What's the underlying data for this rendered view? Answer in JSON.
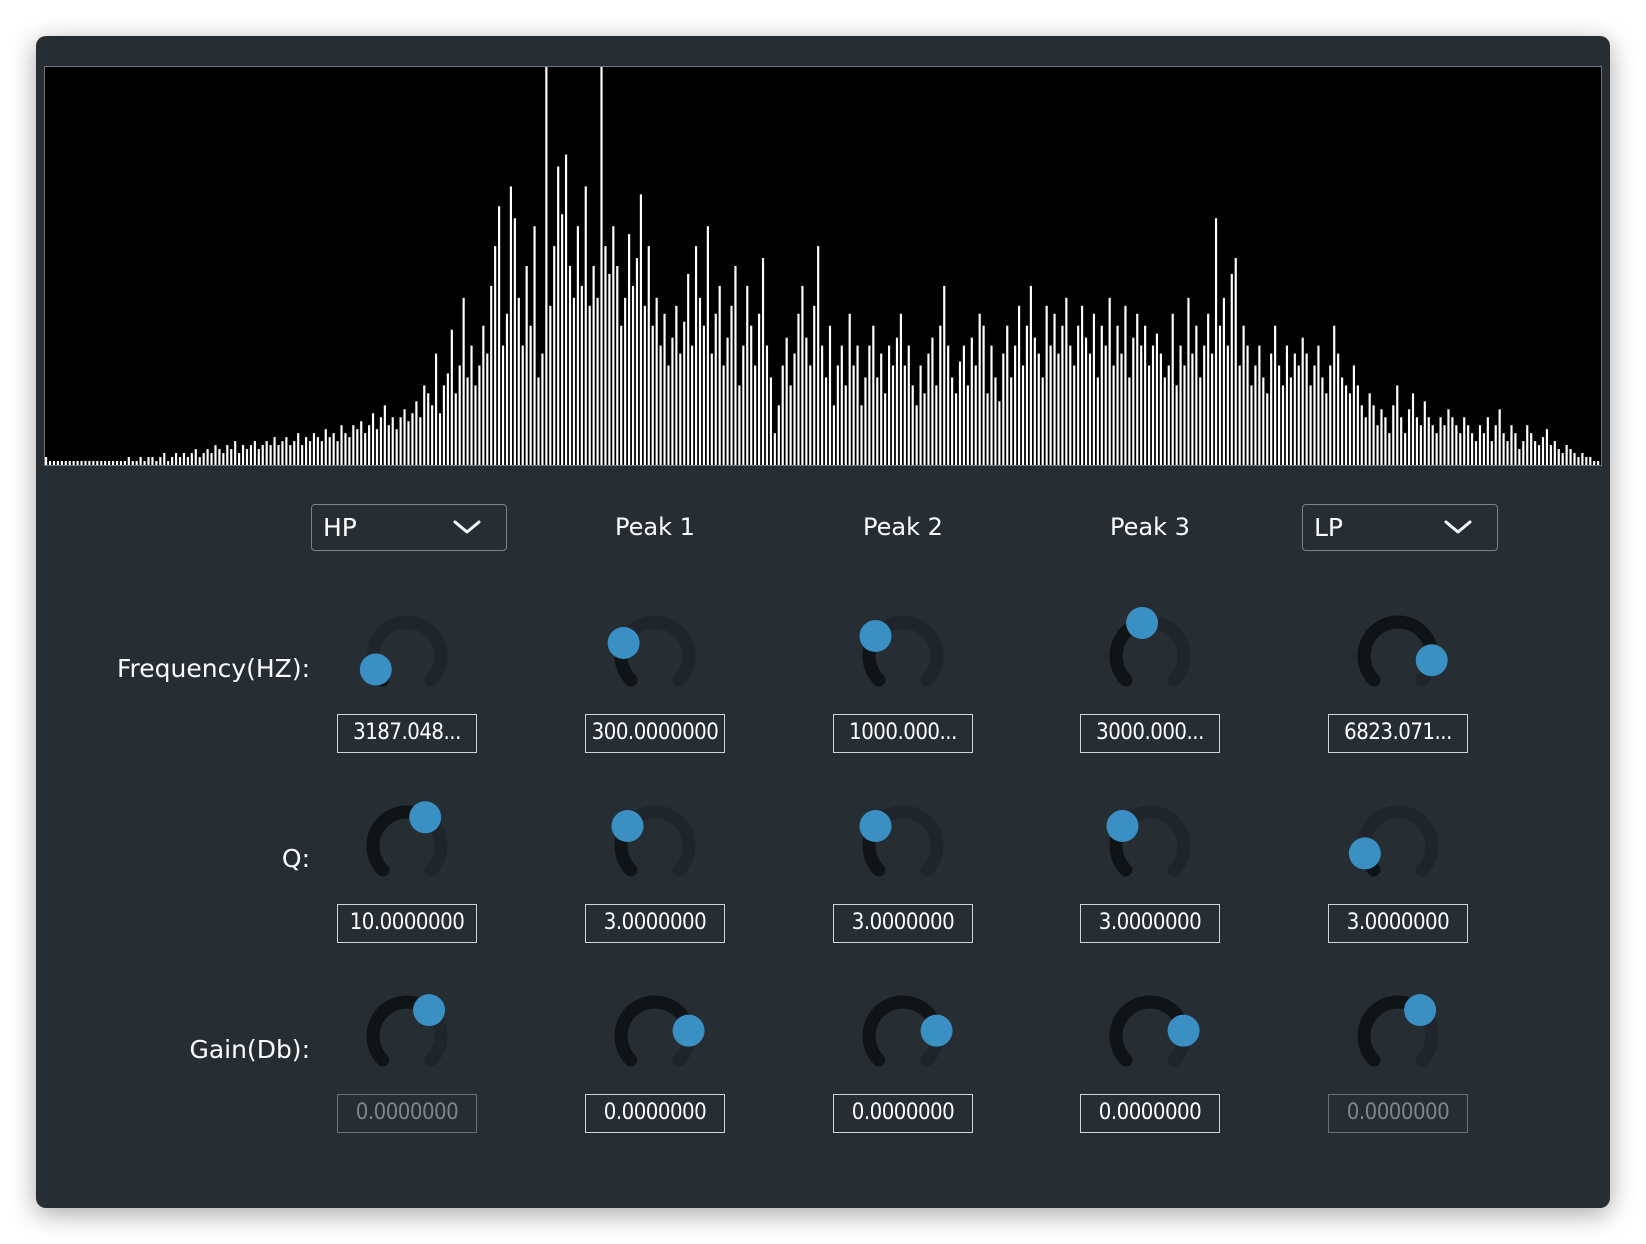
{
  "bands": [
    {
      "kind": "dropdown",
      "title": "HP",
      "enabled_gain": false
    },
    {
      "kind": "label",
      "title": "Peak 1",
      "enabled_gain": true
    },
    {
      "kind": "label",
      "title": "Peak 2",
      "enabled_gain": true
    },
    {
      "kind": "label",
      "title": "Peak 3",
      "enabled_gain": true
    },
    {
      "kind": "dropdown",
      "title": "LP",
      "enabled_gain": false
    }
  ],
  "rows": [
    {
      "label": "Frequency(HZ):",
      "key": "freq"
    },
    {
      "label": "Q:",
      "key": "q"
    },
    {
      "label": "Gain(Db):",
      "key": "gain"
    }
  ],
  "values": {
    "freq": [
      "3187.048...",
      "300.0000000",
      "1000.000...",
      "3000.000...",
      "6823.071..."
    ],
    "q": [
      "10.0000000",
      "3.0000000",
      "3.0000000",
      "3.0000000",
      "3.0000000"
    ],
    "gain": [
      "0.0000000",
      "0.0000000",
      "0.0000000",
      "0.0000000",
      "0.0000000"
    ]
  },
  "knob_levels": {
    "freq": [
      0.08,
      0.25,
      0.3,
      0.45,
      0.86
    ],
    "q": [
      0.62,
      0.3,
      0.3,
      0.3,
      0.12
    ],
    "gain": [
      0.65,
      0.8,
      0.8,
      0.8,
      0.65
    ]
  },
  "colors": {
    "knob_track": "#1f252a",
    "knob_fill": "#111416",
    "knob_thumb": "#3a8fc3",
    "spectrum_bar": "#ffffff",
    "panel": "#262d33"
  },
  "spectrum_levels": [
    0.02,
    0.01,
    0.01,
    0.01,
    0.01,
    0.01,
    0.01,
    0.01,
    0.01,
    0.01,
    0.01,
    0.01,
    0.01,
    0.01,
    0.01,
    0.01,
    0.01,
    0.01,
    0.01,
    0.01,
    0.01,
    0.02,
    0.01,
    0.01,
    0.02,
    0.01,
    0.02,
    0.02,
    0.01,
    0.02,
    0.03,
    0.01,
    0.02,
    0.03,
    0.02,
    0.03,
    0.02,
    0.03,
    0.04,
    0.02,
    0.03,
    0.04,
    0.03,
    0.05,
    0.04,
    0.03,
    0.05,
    0.04,
    0.06,
    0.03,
    0.05,
    0.04,
    0.05,
    0.06,
    0.04,
    0.05,
    0.06,
    0.05,
    0.07,
    0.05,
    0.06,
    0.07,
    0.05,
    0.06,
    0.08,
    0.05,
    0.07,
    0.06,
    0.08,
    0.07,
    0.06,
    0.09,
    0.07,
    0.08,
    0.06,
    0.1,
    0.08,
    0.07,
    0.1,
    0.09,
    0.11,
    0.08,
    0.1,
    0.13,
    0.09,
    0.12,
    0.15,
    0.1,
    0.12,
    0.09,
    0.12,
    0.14,
    0.11,
    0.13,
    0.16,
    0.12,
    0.2,
    0.18,
    0.15,
    0.28,
    0.13,
    0.2,
    0.23,
    0.34,
    0.18,
    0.25,
    0.42,
    0.22,
    0.3,
    0.2,
    0.25,
    0.35,
    0.28,
    0.45,
    0.55,
    0.65,
    0.3,
    0.38,
    0.7,
    0.62,
    0.42,
    0.3,
    0.5,
    0.35,
    0.6,
    0.22,
    0.28,
    1.0,
    0.4,
    0.55,
    0.75,
    0.63,
    0.78,
    0.5,
    0.42,
    0.6,
    0.45,
    0.7,
    0.4,
    0.5,
    0.42,
    1.0,
    0.55,
    0.48,
    0.6,
    0.5,
    0.35,
    0.42,
    0.58,
    0.45,
    0.52,
    0.68,
    0.4,
    0.55,
    0.35,
    0.42,
    0.3,
    0.38,
    0.25,
    0.32,
    0.4,
    0.28,
    0.36,
    0.48,
    0.3,
    0.55,
    0.42,
    0.35,
    0.6,
    0.28,
    0.38,
    0.45,
    0.25,
    0.32,
    0.4,
    0.5,
    0.2,
    0.3,
    0.45,
    0.35,
    0.25,
    0.38,
    0.52,
    0.3,
    0.22,
    0.08,
    0.15,
    0.25,
    0.32,
    0.2,
    0.28,
    0.38,
    0.45,
    0.32,
    0.25,
    0.4,
    0.55,
    0.3,
    0.22,
    0.35,
    0.15,
    0.25,
    0.3,
    0.2,
    0.38,
    0.25,
    0.3,
    0.15,
    0.22,
    0.3,
    0.35,
    0.22,
    0.28,
    0.18,
    0.3,
    0.25,
    0.32,
    0.38,
    0.25,
    0.3,
    0.2,
    0.15,
    0.25,
    0.18,
    0.28,
    0.32,
    0.2,
    0.35,
    0.45,
    0.3,
    0.22,
    0.18,
    0.26,
    0.3,
    0.2,
    0.32,
    0.25,
    0.38,
    0.35,
    0.18,
    0.3,
    0.22,
    0.16,
    0.28,
    0.35,
    0.22,
    0.3,
    0.4,
    0.25,
    0.35,
    0.45,
    0.32,
    0.28,
    0.22,
    0.4,
    0.3,
    0.38,
    0.28,
    0.35,
    0.42,
    0.3,
    0.25,
    0.35,
    0.4,
    0.32,
    0.28,
    0.38,
    0.22,
    0.35,
    0.3,
    0.42,
    0.25,
    0.35,
    0.28,
    0.4,
    0.22,
    0.32,
    0.38,
    0.3,
    0.35,
    0.25,
    0.3,
    0.33,
    0.28,
    0.22,
    0.25,
    0.38,
    0.2,
    0.3,
    0.25,
    0.42,
    0.28,
    0.35,
    0.22,
    0.3,
    0.38,
    0.28,
    0.62,
    0.35,
    0.42,
    0.3,
    0.48,
    0.52,
    0.25,
    0.35,
    0.3,
    0.2,
    0.25,
    0.3,
    0.22,
    0.18,
    0.28,
    0.35,
    0.25,
    0.2,
    0.3,
    0.22,
    0.28,
    0.25,
    0.32,
    0.28,
    0.2,
    0.25,
    0.3,
    0.22,
    0.18,
    0.25,
    0.35,
    0.28,
    0.22,
    0.2,
    0.18,
    0.25,
    0.2,
    0.15,
    0.12,
    0.18,
    0.15,
    0.1,
    0.14,
    0.12,
    0.08,
    0.15,
    0.2,
    0.12,
    0.08,
    0.14,
    0.18,
    0.12,
    0.1,
    0.16,
    0.12,
    0.1,
    0.08,
    0.12,
    0.1,
    0.14,
    0.12,
    0.1,
    0.08,
    0.12,
    0.1,
    0.08,
    0.06,
    0.1,
    0.08,
    0.12,
    0.06,
    0.1,
    0.14,
    0.08,
    0.06,
    0.1,
    0.08,
    0.04,
    0.06,
    0.1,
    0.08,
    0.06,
    0.05,
    0.07,
    0.09,
    0.05,
    0.06,
    0.04,
    0.03,
    0.05,
    0.04,
    0.03,
    0.02,
    0.03,
    0.02,
    0.02,
    0.01,
    0.01
  ]
}
